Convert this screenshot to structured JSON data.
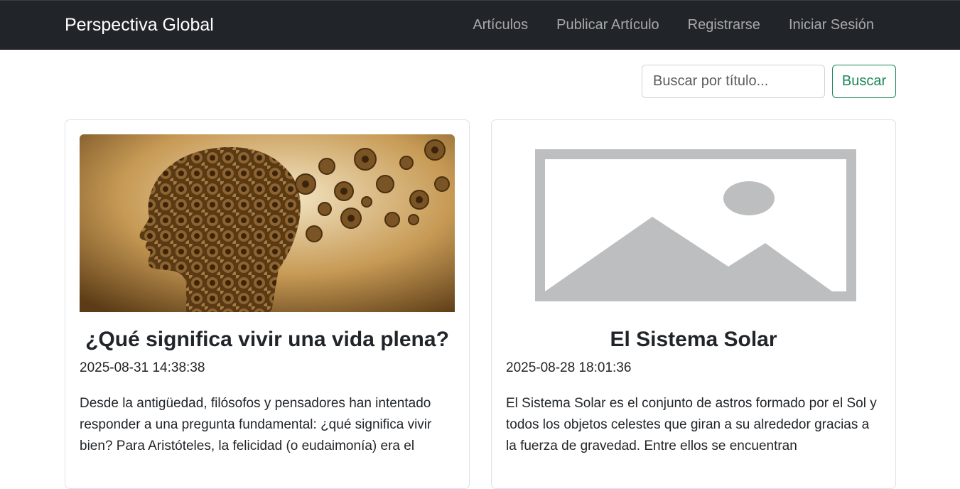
{
  "navbar": {
    "brand": "Perspectiva Global",
    "links": [
      "Artículos",
      "Publicar Artículo",
      "Registrarse",
      "Iniciar Sesión"
    ]
  },
  "search": {
    "placeholder": "Buscar por título...",
    "button": "Buscar"
  },
  "articles": [
    {
      "title": "¿Qué significa vivir una vida plena?",
      "date": "2025-08-31 14:38:38",
      "excerpt": "Desde la antigüedad, filósofos y pensadores han intentado responder a una pregunta fundamental: ¿qué significa vivir bien? Para Aristóteles, la felicidad (o eudaimonía) era el",
      "image": "head-of-gears-image"
    },
    {
      "title": "El Sistema Solar",
      "date": "2025-08-28 18:01:36",
      "excerpt": "El Sistema Solar es el conjunto de astros formado por el Sol y todos los objetos celestes que giran a su alrededor gracias a la fuerza de gravedad. Entre ellos se encuentran",
      "image": "image-placeholder-icon"
    }
  ],
  "colors": {
    "navbar_bg": "#212529",
    "accent_success": "#198754"
  }
}
